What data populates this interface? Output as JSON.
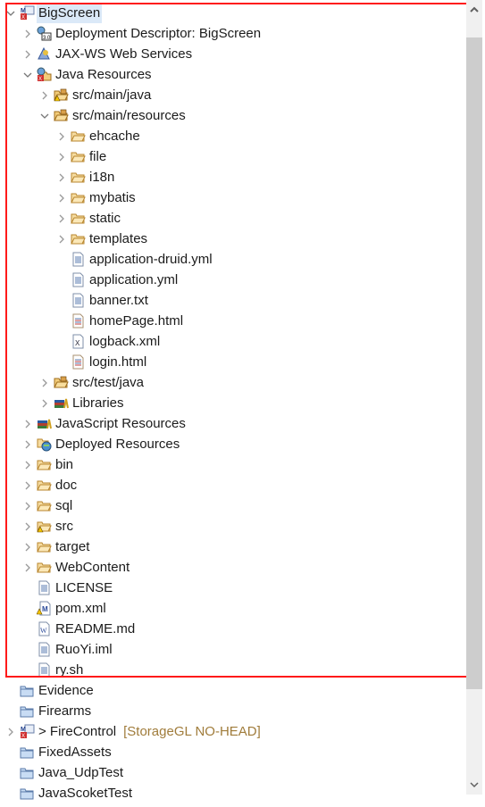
{
  "tree": [
    {
      "level": 0,
      "state": "open",
      "icon": "web-project-icon",
      "label": "BigScreen",
      "selected": true
    },
    {
      "level": 1,
      "state": "closed",
      "icon": "deployment-descriptor-icon",
      "label": "Deployment Descriptor: BigScreen"
    },
    {
      "level": 1,
      "state": "closed",
      "icon": "web-services-icon",
      "label": "JAX-WS Web Services"
    },
    {
      "level": 1,
      "state": "open",
      "icon": "java-resources-icon",
      "label": "Java Resources"
    },
    {
      "level": 2,
      "state": "closed",
      "icon": "source-folder-warning-icon",
      "label": "src/main/java"
    },
    {
      "level": 2,
      "state": "open",
      "icon": "source-folder-icon",
      "label": "src/main/resources"
    },
    {
      "level": 3,
      "state": "closed",
      "icon": "folder-icon",
      "label": "ehcache"
    },
    {
      "level": 3,
      "state": "closed",
      "icon": "folder-icon",
      "label": "file"
    },
    {
      "level": 3,
      "state": "closed",
      "icon": "folder-icon",
      "label": "i18n"
    },
    {
      "level": 3,
      "state": "closed",
      "icon": "folder-icon",
      "label": "mybatis"
    },
    {
      "level": 3,
      "state": "closed",
      "icon": "folder-icon",
      "label": "static"
    },
    {
      "level": 3,
      "state": "closed",
      "icon": "folder-icon",
      "label": "templates"
    },
    {
      "level": 3,
      "state": "none",
      "icon": "text-file-icon",
      "label": "application-druid.yml"
    },
    {
      "level": 3,
      "state": "none",
      "icon": "text-file-icon",
      "label": "application.yml"
    },
    {
      "level": 3,
      "state": "none",
      "icon": "text-file-icon",
      "label": "banner.txt"
    },
    {
      "level": 3,
      "state": "none",
      "icon": "html-file-icon",
      "label": "homePage.html"
    },
    {
      "level": 3,
      "state": "none",
      "icon": "xml-file-icon",
      "label": "logback.xml"
    },
    {
      "level": 3,
      "state": "none",
      "icon": "html-file-icon",
      "label": "login.html"
    },
    {
      "level": 2,
      "state": "closed",
      "icon": "source-folder-icon",
      "label": "src/test/java"
    },
    {
      "level": 2,
      "state": "closed",
      "icon": "libraries-icon",
      "label": "Libraries"
    },
    {
      "level": 1,
      "state": "closed",
      "icon": "libraries-icon",
      "label": "JavaScript Resources"
    },
    {
      "level": 1,
      "state": "closed",
      "icon": "deployed-resources-icon",
      "label": "Deployed Resources"
    },
    {
      "level": 1,
      "state": "closed",
      "icon": "folder-icon",
      "label": "bin"
    },
    {
      "level": 1,
      "state": "closed",
      "icon": "folder-icon",
      "label": "doc"
    },
    {
      "level": 1,
      "state": "closed",
      "icon": "folder-icon",
      "label": "sql"
    },
    {
      "level": 1,
      "state": "closed",
      "icon": "folder-warning-icon",
      "label": "src"
    },
    {
      "level": 1,
      "state": "closed",
      "icon": "folder-icon",
      "label": "target"
    },
    {
      "level": 1,
      "state": "closed",
      "icon": "folder-icon",
      "label": "WebContent"
    },
    {
      "level": 1,
      "state": "none",
      "icon": "text-file-icon",
      "label": "LICENSE"
    },
    {
      "level": 1,
      "state": "none",
      "icon": "maven-pom-icon",
      "label": "pom.xml"
    },
    {
      "level": 1,
      "state": "none",
      "icon": "word-file-icon",
      "label": "README.md"
    },
    {
      "level": 1,
      "state": "none",
      "icon": "text-file-icon",
      "label": "RuoYi.iml"
    },
    {
      "level": 1,
      "state": "none",
      "icon": "text-file-icon",
      "label": "ry.sh"
    },
    {
      "level": 0,
      "state": "none",
      "icon": "closed-project-icon",
      "label": "Evidence"
    },
    {
      "level": 0,
      "state": "none",
      "icon": "closed-project-icon",
      "label": "Firearms"
    },
    {
      "level": 0,
      "state": "closed",
      "icon": "web-project-icon",
      "label": "> FireControl",
      "decoration": "[StorageGL NO-HEAD]"
    },
    {
      "level": 0,
      "state": "none",
      "icon": "closed-project-icon",
      "label": "FixedAssets"
    },
    {
      "level": 0,
      "state": "none",
      "icon": "closed-project-icon",
      "label": "Java_UdpTest"
    },
    {
      "level": 0,
      "state": "none",
      "icon": "closed-project-icon",
      "label": "JavaScoketTest"
    }
  ],
  "colors": {
    "highlight_border": "#ff1a1a",
    "selection": "#dbe9f8",
    "decoration": "#a07c3b"
  }
}
